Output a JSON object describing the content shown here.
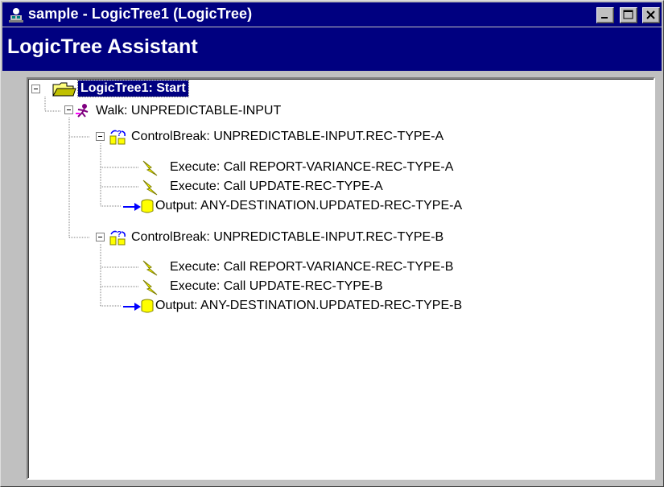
{
  "window": {
    "title": "sample - LogicTree1 (LogicTree)",
    "controls": [
      "minimize",
      "maximize",
      "close"
    ]
  },
  "header": {
    "title": "LogicTree Assistant"
  },
  "tree": {
    "root": {
      "label": "LogicTree1: Start",
      "icon": "folder-open-icon",
      "selected": true
    },
    "walk": {
      "label": "Walk: UNPREDICTABLE-INPUT",
      "icon": "walk-icon"
    },
    "groups": [
      {
        "label": "ControlBreak: UNPREDICTABLE-INPUT.REC-TYPE-A",
        "icon": "control-break-icon",
        "children": [
          {
            "label": "Execute: Call REPORT-VARIANCE-REC-TYPE-A",
            "icon": "lightning-icon"
          },
          {
            "label": "Execute: Call UPDATE-REC-TYPE-A",
            "icon": "lightning-icon"
          },
          {
            "label": "Output: ANY-DESTINATION.UPDATED-REC-TYPE-A",
            "icon": "database-output-icon"
          }
        ]
      },
      {
        "label": "ControlBreak: UNPREDICTABLE-INPUT.REC-TYPE-B",
        "icon": "control-break-icon",
        "children": [
          {
            "label": "Execute: Call REPORT-VARIANCE-REC-TYPE-B",
            "icon": "lightning-icon"
          },
          {
            "label": "Execute: Call UPDATE-REC-TYPE-B",
            "icon": "lightning-icon"
          },
          {
            "label": "Output: ANY-DESTINATION.UPDATED-REC-TYPE-B",
            "icon": "database-output-icon"
          }
        ]
      }
    ]
  },
  "colors": {
    "title_bar": "#000080",
    "face": "#c0c0c0",
    "tree_bg": "#ffffff",
    "selection": "#000080"
  }
}
